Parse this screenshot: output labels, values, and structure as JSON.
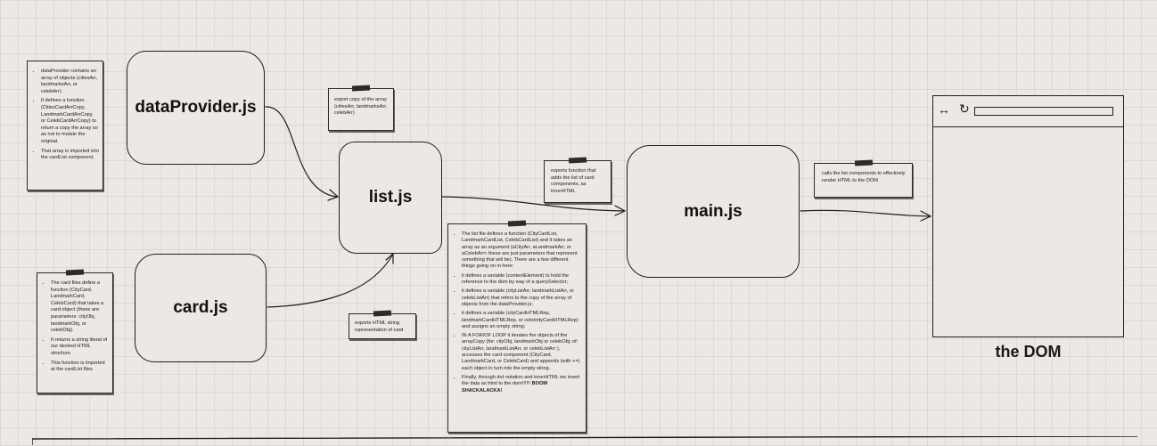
{
  "nodes": {
    "dataProvider": {
      "label": "dataProvider.js"
    },
    "list": {
      "label": "list.js"
    },
    "card": {
      "label": "card.js"
    },
    "main": {
      "label": "main.js"
    }
  },
  "notes": {
    "dataProvider_desc": [
      "dataProvider contains an array of objects (citiesArr, landmarksArr, or celebArr).",
      "It defines a function (CitiesCardArrCopy, LandmarkCardArrCopy, or CelebCardArrCopy) to return a copy the array so as not to mutate the original.",
      "That array is imported into the cardList component."
    ],
    "card_desc": [
      "The card files define a function (CityCard, LandmarkCard, CelebCard) that takes a card object (these are parameters: cityObj, landmarkObj, or celebObj).",
      "It returns a string literal of our desired HTML structure.",
      "This function is imported at the cardList files."
    ],
    "export_copy": "export copy of the array (citiesArr, landmarksArr, celebArr)",
    "exports_html_string": "exports HTML string representation of card",
    "exports_function": "exports function that adds the list of card components, as innerHTML",
    "calls_list": "calls the list components to effectively render HTML to the DOM",
    "list_desc": [
      "The list file defines a function (CityCardList, LandmarkCardList, CelebCardList) and it takes an array as an argument (aCityArr, aLandmarkArr, or aCelebArr< these are just parameters that represent something that will be). There are a few different things going on in here:",
      "it defines a variable (contentElement) to hold the reference to the dom by way of a querySelector;",
      "it defines a variable (cityListArr, landmarkListArr, or celebListArr) that refers to the copy of the array of objects from the dataProvider.js;",
      "it defines a variable (cityCardHTMLRep, landmarkCardHTMLRep, or celebrityCardHTMLRep) and assigns an empty string;",
      "IN A FOR/OF LOOP it iterates the objects of the arrayCopy (for: cityObj, landmarkObj or celebObj; of: cityListArr, landmarkListArr, or celebListArr ), accesses the card component (CityCard, LandmarkCard, or CelebCard) and appends (with +=) each object in turn into the empty string.",
      "Finally, through dot notation and innerHTML we insert the data as html to the dom!!!!!! "
    ],
    "list_desc_emphasis": "BOOM SHACKALACKA!"
  },
  "browser": {
    "nav_icon": "back-forward-arrows-icon",
    "reload_icon": "reload-icon",
    "nav_glyph": "↔",
    "reload_glyph": "↻",
    "label": "the DOM"
  }
}
